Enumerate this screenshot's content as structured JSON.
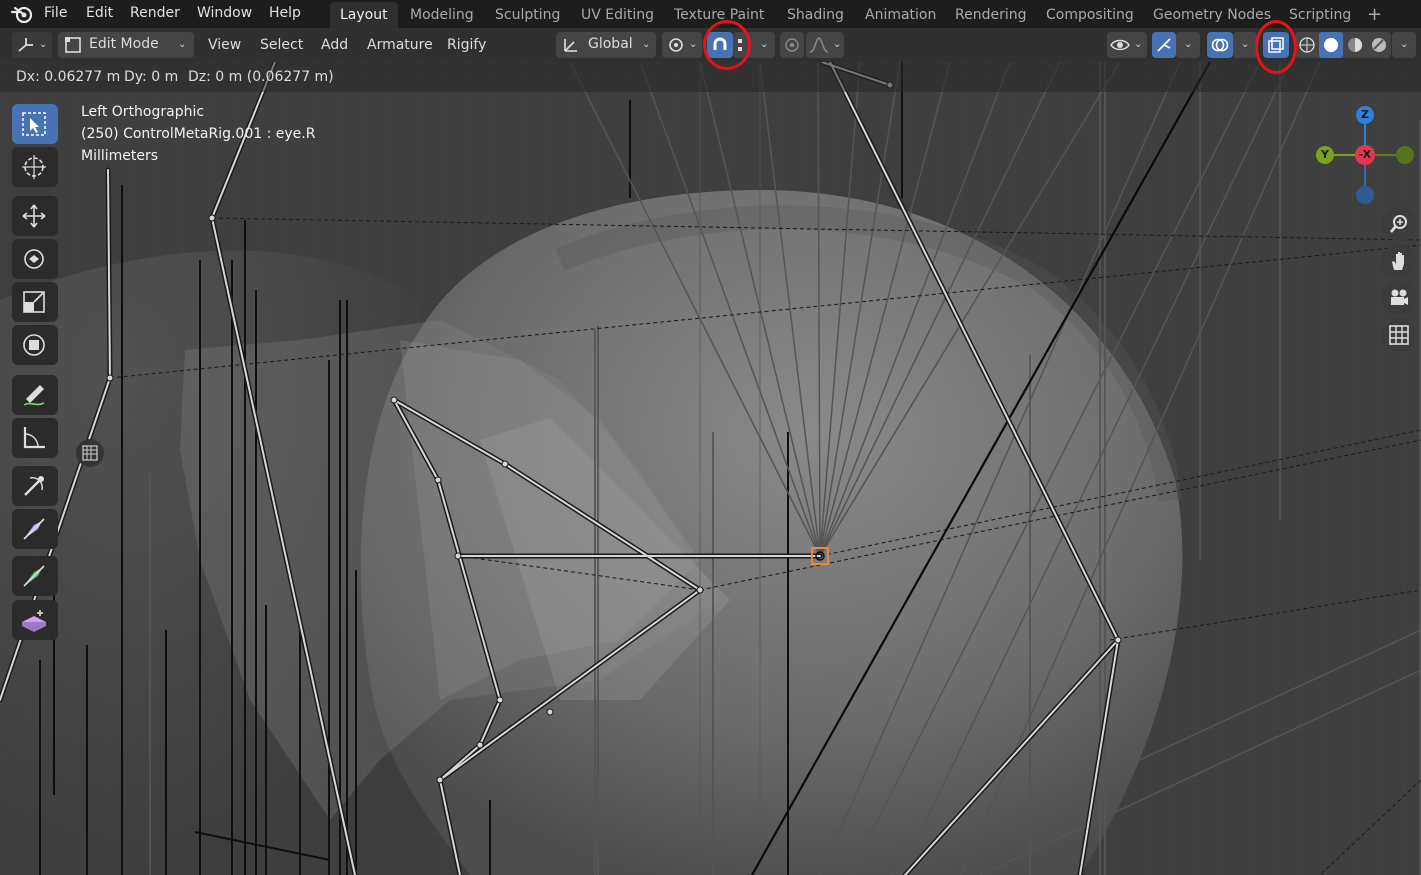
{
  "menubar": {
    "items": [
      "File",
      "Edit",
      "Render",
      "Window",
      "Help"
    ]
  },
  "workspaces": {
    "tabs": [
      "Layout",
      "Modeling",
      "Sculpting",
      "UV Editing",
      "Texture Paint",
      "Shading",
      "Animation",
      "Rendering",
      "Compositing",
      "Geometry Nodes",
      "Scripting"
    ],
    "active": "Layout",
    "add_label": "+"
  },
  "header": {
    "mode_label": "Edit Mode",
    "view_label": "View",
    "select_label": "Select",
    "add_label": "Add",
    "armature_label": "Armature",
    "rigify_label": "Rigify",
    "orientation_label": "Global"
  },
  "status": {
    "dx": "Dx: 0.06277 m",
    "dy": "Dy: 0 m",
    "dz": "Dz: 0 m (0.06277 m)"
  },
  "viewport": {
    "view_name": "Left Orthographic",
    "object_info": "(250) ControlMetaRig.001 : eye.R",
    "units": "Millimeters"
  },
  "gizmo": {
    "z_label": "Z",
    "y_label": "Y",
    "negx_label": "-X"
  },
  "colors": {
    "accent": "#4772b3",
    "annotation": "#e0141a",
    "axis_x": "#e8344e",
    "axis_y": "#7ba21b",
    "axis_z": "#2f7fdc",
    "selected_bone": "#e58a3c"
  },
  "icons": {
    "snap": "magnet-icon",
    "xray": "xray-toggle-icon",
    "tools": [
      "select-box-icon",
      "cursor-icon",
      "move-icon",
      "rotate-icon",
      "scale-icon",
      "transform-icon",
      "annotate-icon",
      "measure-icon",
      "bone-roll-icon",
      "bone-size-icon",
      "bone-envelope-icon",
      "extrude-icon"
    ]
  }
}
